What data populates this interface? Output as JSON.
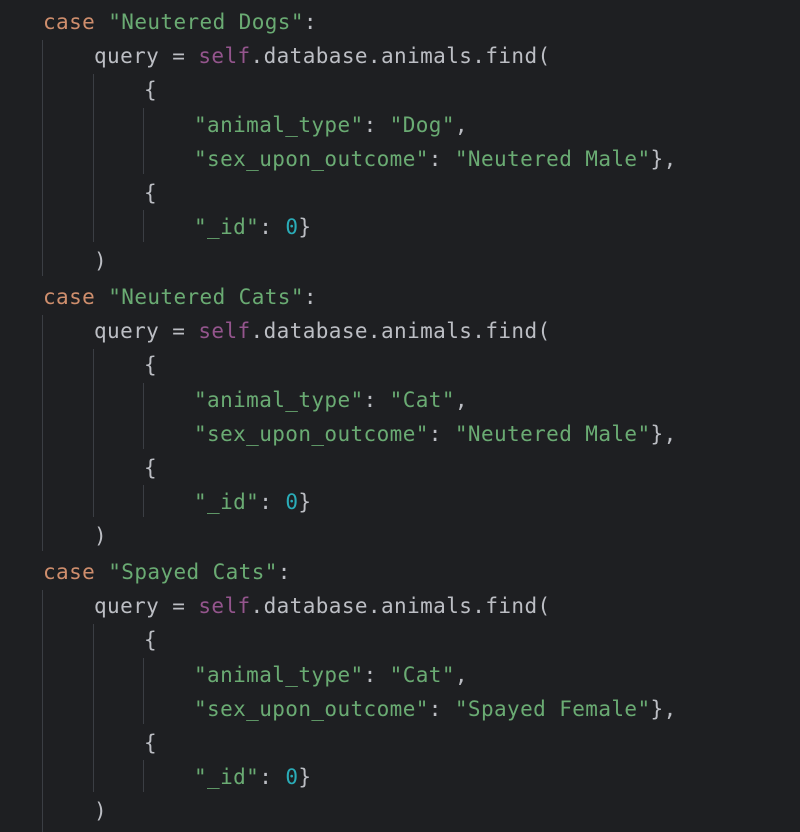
{
  "code": {
    "language": "python",
    "blocks": [
      {
        "case_keyword": "case",
        "case_value": "\"Neutered Dogs\"",
        "case_colon": ":",
        "query_var": "query",
        "assign": " = ",
        "self_kw": "self",
        "call": ".database.animals.find(",
        "open_brace_1": "{",
        "key_type": "\"animal_type\"",
        "colon_space_1": ": ",
        "val_type": "\"Dog\"",
        "comma_1": ",",
        "key_sex": "\"sex_upon_outcome\"",
        "colon_space_2": ": ",
        "val_sex": "\"Neutered Male\"",
        "close_brace_comma": "},",
        "open_brace_2": "{",
        "key_id": "\"_id\"",
        "colon_space_3": ": ",
        "val_id": "0",
        "close_brace": "}",
        "close_paren": ")"
      },
      {
        "case_keyword": "case",
        "case_value": "\"Neutered Cats\"",
        "case_colon": ":",
        "query_var": "query",
        "assign": " = ",
        "self_kw": "self",
        "call": ".database.animals.find(",
        "open_brace_1": "{",
        "key_type": "\"animal_type\"",
        "colon_space_1": ": ",
        "val_type": "\"Cat\"",
        "comma_1": ",",
        "key_sex": "\"sex_upon_outcome\"",
        "colon_space_2": ": ",
        "val_sex": "\"Neutered Male\"",
        "close_brace_comma": "},",
        "open_brace_2": "{",
        "key_id": "\"_id\"",
        "colon_space_3": ": ",
        "val_id": "0",
        "close_brace": "}",
        "close_paren": ")"
      },
      {
        "case_keyword": "case",
        "case_value": "\"Spayed Cats\"",
        "case_colon": ":",
        "query_var": "query",
        "assign": " = ",
        "self_kw": "self",
        "call": ".database.animals.find(",
        "open_brace_1": "{",
        "key_type": "\"animal_type\"",
        "colon_space_1": ": ",
        "val_type": "\"Cat\"",
        "comma_1": ",",
        "key_sex": "\"sex_upon_outcome\"",
        "colon_space_2": ": ",
        "val_sex": "\"Spayed Female\"",
        "close_brace_comma": "},",
        "open_brace_2": "{",
        "key_id": "\"_id\"",
        "colon_space_3": ": ",
        "val_id": "0",
        "close_brace": "}",
        "close_paren": ")"
      }
    ]
  },
  "colors": {
    "background": "#1e1f22",
    "keyword": "#cf8e6d",
    "string": "#6aab73",
    "self": "#94558d",
    "number": "#2aacb8",
    "text": "#bcbec4",
    "indent_guide": "#3b3e44"
  }
}
